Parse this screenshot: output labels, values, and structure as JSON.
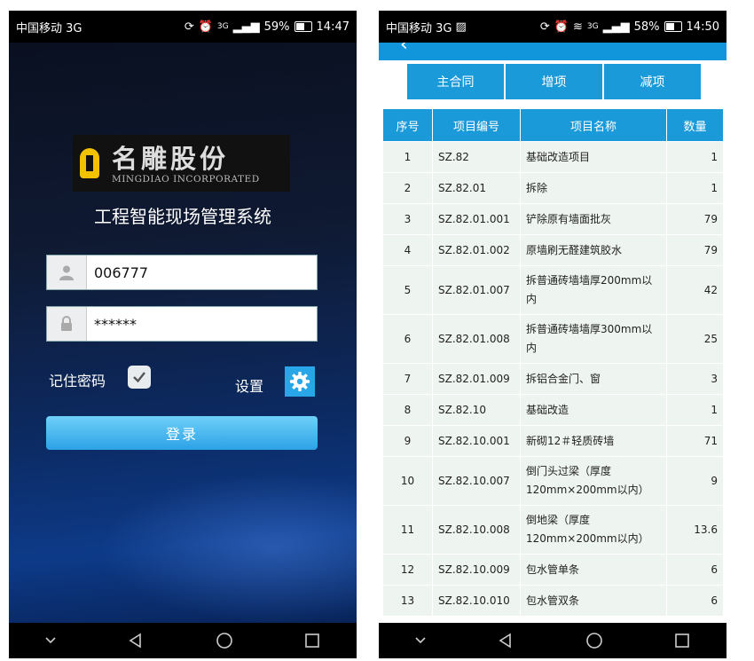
{
  "left": {
    "status": {
      "carrier": "中国移动 3G",
      "signal": "3G",
      "battery": "59%",
      "time": "14:47"
    },
    "logo": {
      "name": "名雕股份",
      "english": "MINGDIAO INCORPORATED"
    },
    "system_title": "工程智能现场管理系统",
    "username": "006777",
    "password": "******",
    "remember_label": "记住密码",
    "settings_label": "设置",
    "login_label": "登录"
  },
  "right": {
    "status": {
      "carrier": "中国移动 3G",
      "signal": "3G",
      "battery": "58%",
      "time": "14:50"
    },
    "tabs": [
      "主合同",
      "增项",
      "减项"
    ],
    "columns": [
      "序号",
      "项目编号",
      "项目名称",
      "数量"
    ],
    "rows": [
      {
        "idx": "1",
        "code": "SZ.82",
        "name": "基础改造项目",
        "qty": "1"
      },
      {
        "idx": "2",
        "code": "SZ.82.01",
        "name": "拆除",
        "qty": "1"
      },
      {
        "idx": "3",
        "code": "SZ.82.01.001",
        "name": "铲除原有墙面批灰",
        "qty": "79"
      },
      {
        "idx": "4",
        "code": "SZ.82.01.002",
        "name": "原墙刷无醛建筑胶水",
        "qty": "79"
      },
      {
        "idx": "5",
        "code": "SZ.82.01.007",
        "name": "拆普通砖墙墙厚200mm以内",
        "qty": "42"
      },
      {
        "idx": "6",
        "code": "SZ.82.01.008",
        "name": "拆普通砖墙墙厚300mm以内",
        "qty": "25"
      },
      {
        "idx": "7",
        "code": "SZ.82.01.009",
        "name": "拆铝合金门、窗",
        "qty": "3"
      },
      {
        "idx": "8",
        "code": "SZ.82.10",
        "name": "基础改造",
        "qty": "1"
      },
      {
        "idx": "9",
        "code": "SZ.82.10.001",
        "name": "新砌12＃轻质砖墙",
        "qty": "71"
      },
      {
        "idx": "10",
        "code": "SZ.82.10.007",
        "name": "倒门头过梁（厚度120mm×200mm以内）",
        "qty": "9"
      },
      {
        "idx": "11",
        "code": "SZ.82.10.008",
        "name": "倒地梁（厚度120mm×200mm以内）",
        "qty": "13.6"
      },
      {
        "idx": "12",
        "code": "SZ.82.10.009",
        "name": "包水管单条",
        "qty": "6"
      },
      {
        "idx": "13",
        "code": "SZ.82.10.010",
        "name": "包水管双条",
        "qty": "6"
      }
    ]
  },
  "colors": {
    "accent_blue": "#1a9ad9",
    "login_button": "#2ca2e6",
    "cell_bg": "#eef4ef"
  }
}
